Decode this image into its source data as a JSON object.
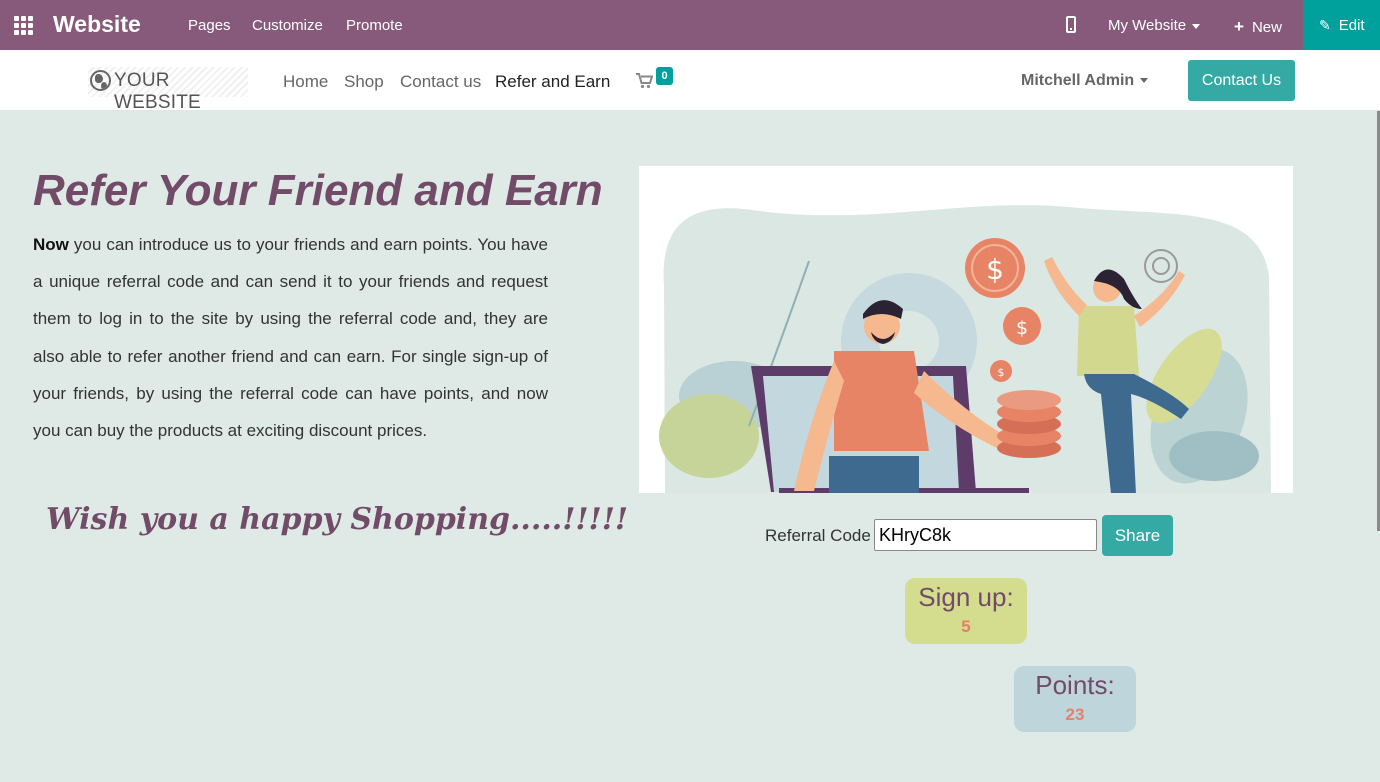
{
  "admin_bar": {
    "brand": "Website",
    "menus": [
      "Pages",
      "Customize",
      "Promote"
    ],
    "website_selector": "My Website",
    "new_label": "New",
    "edit_label": "Edit"
  },
  "header": {
    "logo_text": "YOUR WEBSITE",
    "nav": [
      "Home",
      "Shop",
      "Contact us",
      "Refer and Earn"
    ],
    "active_nav": "Refer and Earn",
    "cart_count": "0",
    "user": "Mitchell Admin",
    "contact_button": "Contact Us"
  },
  "main": {
    "heading": "Refer Your Friend and Earn",
    "intro_bold": "Now",
    "intro_text": " you can introduce us to your friends and earn points. You have a unique referral code and can send it to your friends and request them to log in to the site by using the referral code and, they are also able to refer another friend and can earn. For single sign-up of your friends, by using the referral code can have points, and now you can buy the products at exciting discount prices.",
    "wish": "Wish you a happy Shopping.....!!!!!",
    "referral_label": "Referral Code",
    "referral_code": "KHryC8k",
    "share_label": "Share",
    "signup_label": "Sign up:",
    "signup_value": "5",
    "points_label": "Points:",
    "points_value": "23"
  },
  "colors": {
    "admin_bar": "#875a7b",
    "edit_button": "#00a09d",
    "primary_button": "#35a9a4",
    "heading": "#714b67",
    "background": "#dfe9e6",
    "signup_box": "#d4dc8e",
    "points_box": "#bfd5dc",
    "stat_value": "#e4806b"
  }
}
